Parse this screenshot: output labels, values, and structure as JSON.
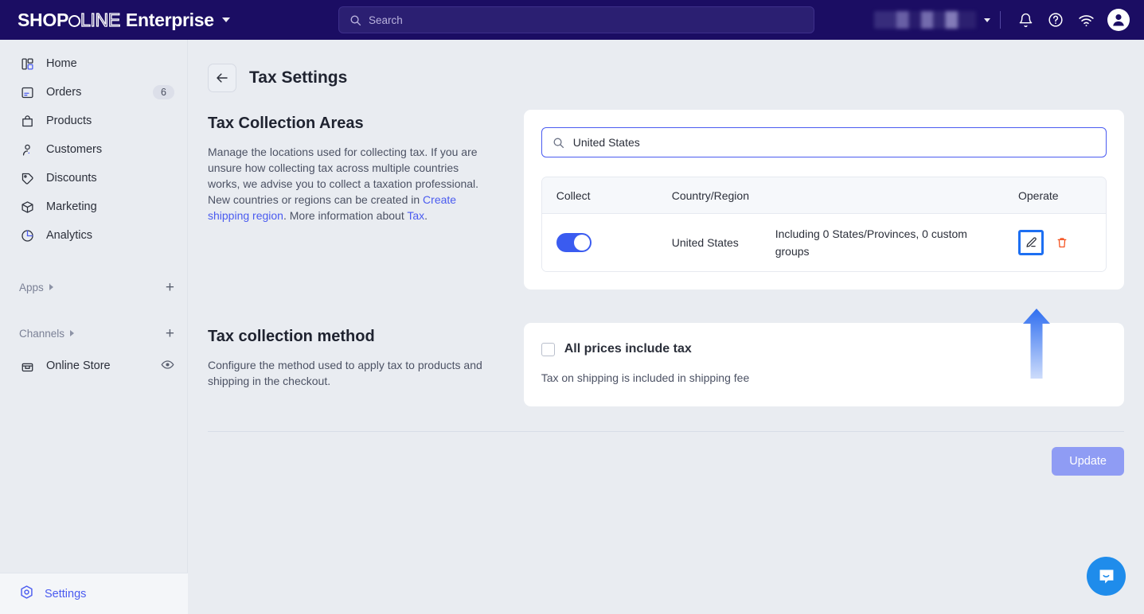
{
  "topbar": {
    "logo_shop": "SHOP",
    "logo_line": "LINE",
    "logo_enterprise": "Enterprise",
    "search_placeholder": "Search",
    "store_name_redacted": "",
    "brand_color": "#1b0d63"
  },
  "sidebar": {
    "items": [
      {
        "label": "Home",
        "icon": "home-icon",
        "badge": ""
      },
      {
        "label": "Orders",
        "icon": "orders-icon",
        "badge": "6"
      },
      {
        "label": "Products",
        "icon": "products-icon",
        "badge": ""
      },
      {
        "label": "Customers",
        "icon": "customers-icon",
        "badge": ""
      },
      {
        "label": "Discounts",
        "icon": "discounts-icon",
        "badge": ""
      },
      {
        "label": "Marketing",
        "icon": "marketing-icon",
        "badge": ""
      },
      {
        "label": "Analytics",
        "icon": "analytics-icon",
        "badge": ""
      }
    ],
    "apps_group": "Apps",
    "channels_group": "Channels",
    "online_store": "Online Store",
    "settings": "Settings",
    "settings_color": "#4a5bf0"
  },
  "page": {
    "title": "Tax Settings"
  },
  "tax_areas": {
    "heading": "Tax Collection Areas",
    "desc_1": "Manage the locations used for collecting tax. If you are unsure how collecting tax across multiple countries works, we advise you to collect a taxation professional. New countries or regions can be created in ",
    "link_1": "Create shipping region",
    "desc_2": ". More information about ",
    "link_2": "Tax",
    "desc_3": ".",
    "search_value": "United States",
    "columns": {
      "collect": "Collect",
      "country": "Country/Region",
      "operate": "Operate"
    },
    "rows": [
      {
        "collect_on": true,
        "country": "United States",
        "detail": "Including 0 States/Provinces, 0 custom groups"
      }
    ]
  },
  "tax_method": {
    "heading": "Tax collection method",
    "desc": "Configure the method used to apply tax to products and shipping in the checkout.",
    "checkbox_label": "All prices include tax",
    "checkbox_checked": false,
    "note": "Tax on shipping is included in shipping fee"
  },
  "footer": {
    "update_label": "Update",
    "update_color": "#8f9cf4"
  },
  "annotation": {
    "highlight_target": "edit-row-button",
    "arrow_color": "#3a78f2"
  }
}
